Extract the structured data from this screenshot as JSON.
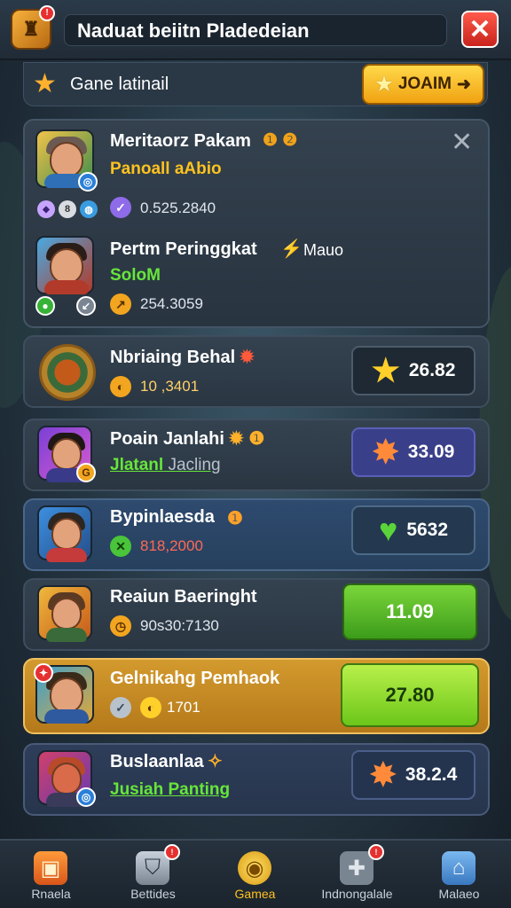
{
  "header": {
    "title": "Naduat beiitn Pladedeian",
    "logo_badge": "!",
    "close_label": "✕"
  },
  "filter": {
    "label": "Gane latinail",
    "join_label": "JOAIM"
  },
  "featured": [
    {
      "name": "Meritaorz Pakam",
      "subtitle": "Panoall aAbio",
      "stat": "0.525.2840"
    },
    {
      "name": "Pertm Peringgkat",
      "name_suffix": "Mauo",
      "subtitle": "SoloM",
      "stat": "254.3059"
    }
  ],
  "rows": [
    {
      "name": "Nbriaing Behal",
      "stat": "10 ,3401",
      "score": "26.82"
    },
    {
      "name": "Poain Janlahi",
      "subtitle": "Jlatanl",
      "subtitle_rest": "Jacling",
      "score": "33.09"
    },
    {
      "name": "Bypinlaesda",
      "stat": "818,2000",
      "score": "5632"
    },
    {
      "name": "Reaiun Baeringht",
      "stat": "90s30:7130",
      "score": "11.09"
    },
    {
      "name": "Gelnikahg Pemhaok",
      "stat": "1701",
      "score": "27.80"
    },
    {
      "name": "Buslaanlaa",
      "subtitle": "Jusiah Panting",
      "score": "38.2.4"
    }
  ],
  "nav": [
    {
      "label": "Rnaela"
    },
    {
      "label": "Bettides",
      "badge": "!"
    },
    {
      "label": "Gamea"
    },
    {
      "label": "Indnongalale",
      "badge": "!"
    },
    {
      "label": "Malaeo"
    }
  ],
  "colors": {
    "accent_yellow": "#ffc21f",
    "accent_green": "#66e63a",
    "close_red": "#e63030",
    "highlight_orange": "#c98a22"
  }
}
